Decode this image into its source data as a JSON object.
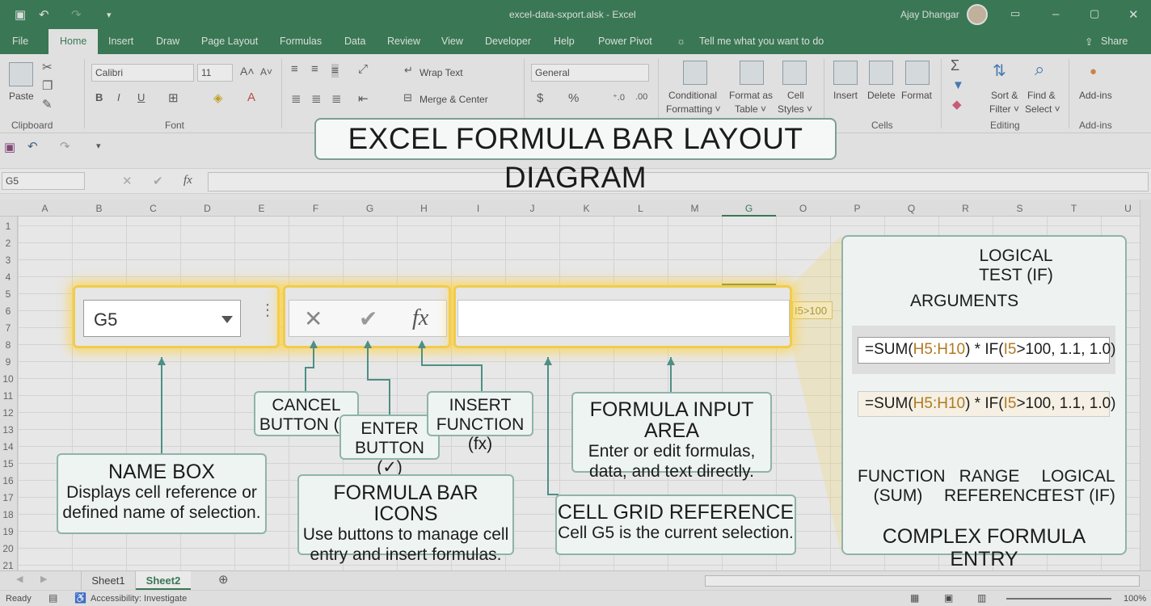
{
  "window": {
    "doc_title": "excel-data-sxport.alsk  -  Excel",
    "user": "Ajay Dhangar"
  },
  "tabs": [
    "File",
    "Home",
    "Insert",
    "Draw",
    "Page Layout",
    "Formulas",
    "Data",
    "Review",
    "View",
    "Developer",
    "Help",
    "Power Pivot",
    "Tell me what you want to do",
    "Share"
  ],
  "ribbon": {
    "paste": "Paste",
    "font_name": "Calibri",
    "font_size": "11",
    "wrap_text": "Wrap Text",
    "merge_center": "Merge & Center",
    "number_format": "General",
    "conditional": [
      "Conditional",
      "Formatting ˅"
    ],
    "format_table": [
      "Format as",
      "Table ˅"
    ],
    "cell_styles": [
      "Cell",
      "Styles ˅"
    ],
    "insert": "Insert",
    "delete": "Delete",
    "format": "Format",
    "sort_filter": [
      "Sort &",
      "Filter ˅"
    ],
    "find_select": [
      "Find &",
      "Select ˅"
    ],
    "addins": "Add-ins",
    "groups": [
      "Clipboard",
      "Font",
      "Cells",
      "Editing",
      "Add-ins"
    ]
  },
  "formula_bar_small": {
    "name_box": "G5",
    "fx": "fx"
  },
  "columns": [
    "A",
    "B",
    "C",
    "D",
    "E",
    "F",
    "G",
    "H",
    "I",
    "J",
    "K",
    "L",
    "M",
    "G",
    "O",
    "P",
    "Q",
    "R",
    "S",
    "T",
    "U"
  ],
  "rows": [
    "1",
    "2",
    "3",
    "4",
    "5",
    "6",
    "7",
    "8",
    "9",
    "10",
    "11",
    "12",
    "13",
    "14",
    "15",
    "16",
    "17",
    "18",
    "19",
    "20",
    "21"
  ],
  "cell_snippet": "I5>100",
  "diagram": {
    "title": "EXCEL FORMULA BAR LAYOUT DIAGRAM",
    "name_box_value": "G5",
    "icons": {
      "cancel": "✕",
      "enter": "✔",
      "fx": "fx"
    },
    "callouts": {
      "cancel": [
        "CANCEL",
        "BUTTON (x)"
      ],
      "enter": [
        "ENTER",
        "BUTTON (✓)"
      ],
      "insert_fn": [
        "INSERT",
        "FUNCTION (fx)"
      ],
      "formula_input": {
        "title": "FORMULA INPUT AREA",
        "body": [
          "Enter or edit formulas,",
          "data, and text directly."
        ]
      },
      "name_box": {
        "title": "NAME BOX",
        "body": [
          "Displays cell reference or",
          "defined name of selection."
        ]
      },
      "fbar_icons": {
        "title": "FORMULA BAR ICONS",
        "body": [
          "Use buttons to manage cell",
          "entry and insert formulas."
        ]
      },
      "cell_grid": {
        "title": "CELL GRID REFERENCE",
        "body": [
          "Cell G5 is the current selection."
        ]
      }
    },
    "panel": {
      "logical_test_top": [
        "LOGICAL",
        "TEST (IF)"
      ],
      "arguments": "ARGUMENTS",
      "formula_parts": [
        "=SUM(",
        "H5:H10",
        ") * IF(",
        "I5",
        ">100, 1.1, 1.0)"
      ],
      "bottom_labels": [
        [
          "FUNCTION",
          "(SUM)"
        ],
        [
          "RANGE",
          "REFERENCE"
        ],
        [
          "LOGICAL",
          "TEST (IF)"
        ]
      ],
      "footer": "COMPLEX FORMULA ENTRY"
    }
  },
  "sheets": [
    "Sheet1",
    "Sheet2"
  ],
  "status": {
    "ready": "Ready",
    "accessibility": "Accessibility: Investigate",
    "zoom": "100%"
  }
}
